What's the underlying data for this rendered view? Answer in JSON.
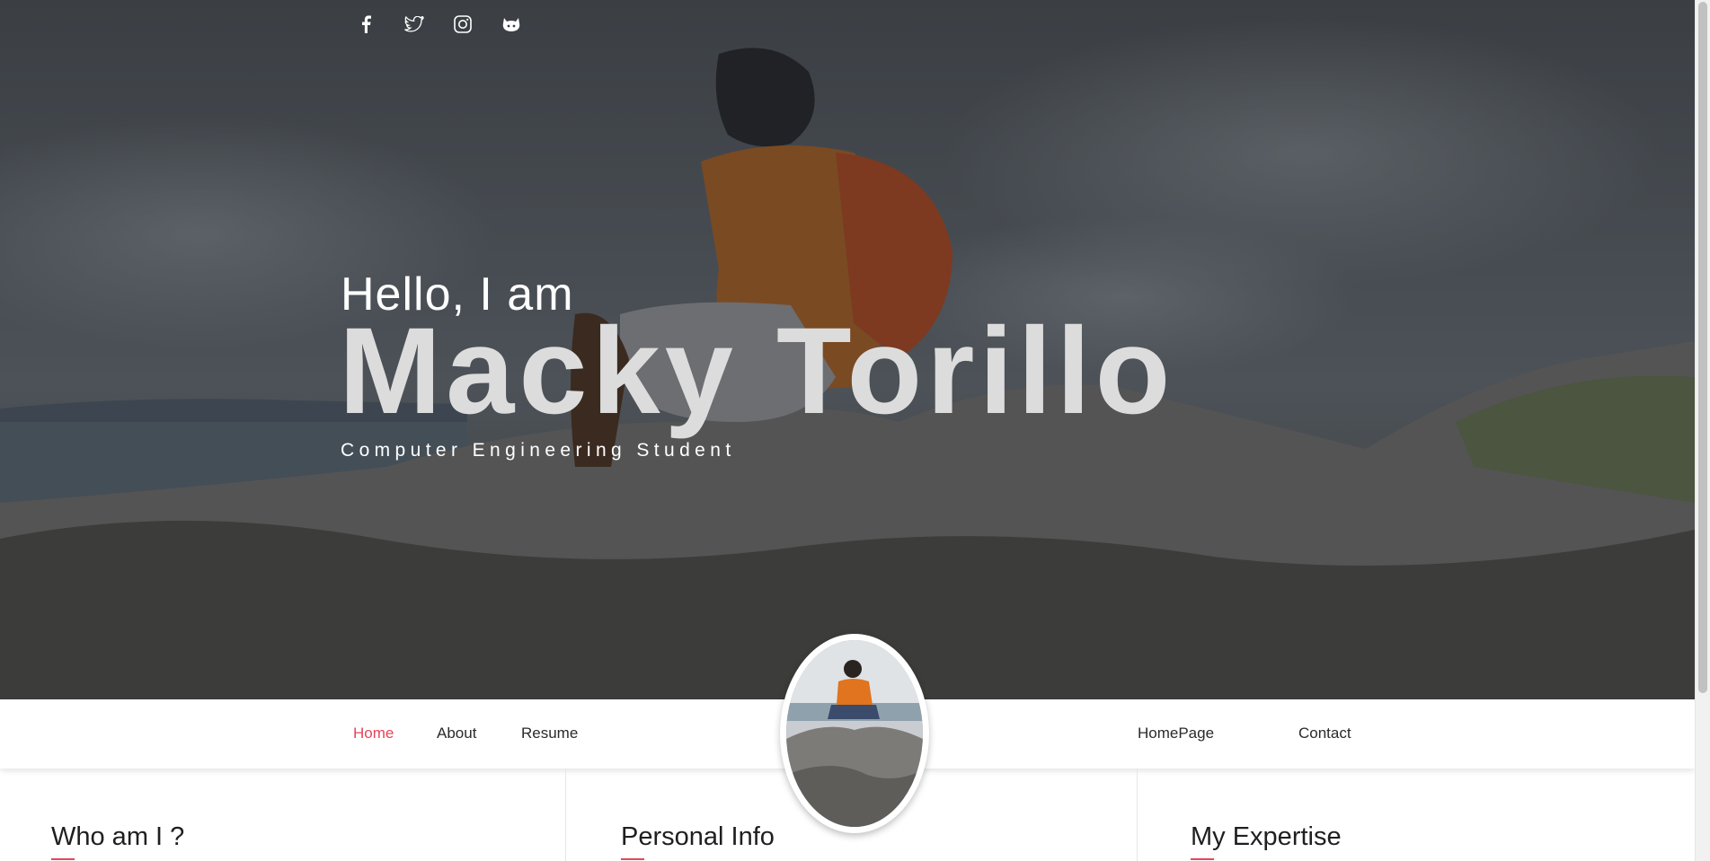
{
  "social": [
    {
      "icon": "facebook-icon"
    },
    {
      "icon": "twitter-icon"
    },
    {
      "icon": "instagram-icon"
    },
    {
      "icon": "github-icon"
    }
  ],
  "hero": {
    "greeting": "Hello, I am",
    "name": "Macky Torillo",
    "role": "Computer Engineering Student"
  },
  "nav": {
    "left": [
      {
        "label": "Home",
        "active": true
      },
      {
        "label": "About",
        "active": false
      },
      {
        "label": "Resume",
        "active": false
      }
    ],
    "right": [
      {
        "label": "HomePage"
      },
      {
        "label": "Contact"
      }
    ]
  },
  "sections": {
    "who_title": "Who am I ?",
    "personal_title": "Personal Info",
    "expertise_title": "My Expertise"
  },
  "colors": {
    "accent": "#e8445a",
    "text_dark": "#1f1f1f"
  }
}
